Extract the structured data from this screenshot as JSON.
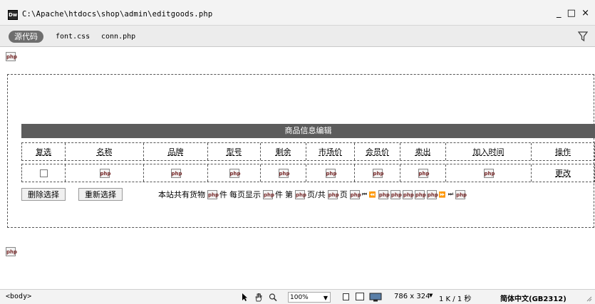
{
  "window": {
    "title": "C:\\Apache\\htdocs\\shop\\admin\\editgoods.php",
    "controls": [
      "_",
      "□",
      "×"
    ]
  },
  "file_bar": {
    "source_button": "源代码",
    "related_files": [
      "font.css",
      "conn.php"
    ]
  },
  "php_placeholder": "php",
  "table": {
    "title": "商品信息编辑",
    "headers": [
      "复选",
      "名称",
      "品牌",
      "型号",
      "剩余",
      "市场价",
      "会员价",
      "卖出",
      "加入时间",
      "操作"
    ],
    "row_action": "更改"
  },
  "buttons": {
    "delete": "删除选择",
    "reselect": "重新选择"
  },
  "pager": {
    "total_prefix": "本站共有货物",
    "unit": "件",
    "per_page": "每页显示",
    "page_no": "第",
    "total_pages": "页/共",
    "page": "页",
    "first_icon": "⏮",
    "prev_icon": "⏪",
    "next_icon": "⏩",
    "last_icon": "⏭"
  },
  "status_bar": {
    "tag": "<body>",
    "zoom": "100%",
    "dimensions": "786 x 324",
    "file_size": "1 K / 1 秒",
    "encoding": "简体中文(GB2312)"
  }
}
